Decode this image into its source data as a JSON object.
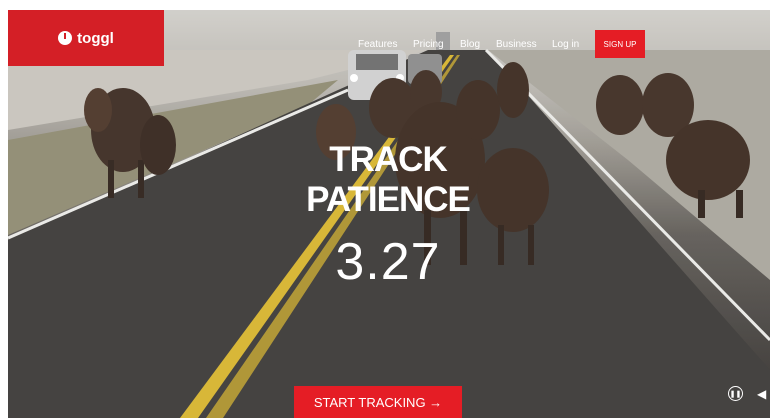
{
  "brand": {
    "name": "toggl",
    "accent": "#e51d25"
  },
  "nav": {
    "items": [
      {
        "label": "Features"
      },
      {
        "label": "Pricing"
      },
      {
        "label": "Blog"
      },
      {
        "label": "Business"
      },
      {
        "label": "Log in"
      }
    ],
    "signup_label": "SIGN UP"
  },
  "hero": {
    "headline_line1": "TRACK",
    "headline_line2": "PATIENCE",
    "timer": "3.27",
    "cta_label": "START TRACKING →"
  },
  "media": {
    "pause_icon": "pause-icon",
    "volume_icon": "volume-icon"
  }
}
